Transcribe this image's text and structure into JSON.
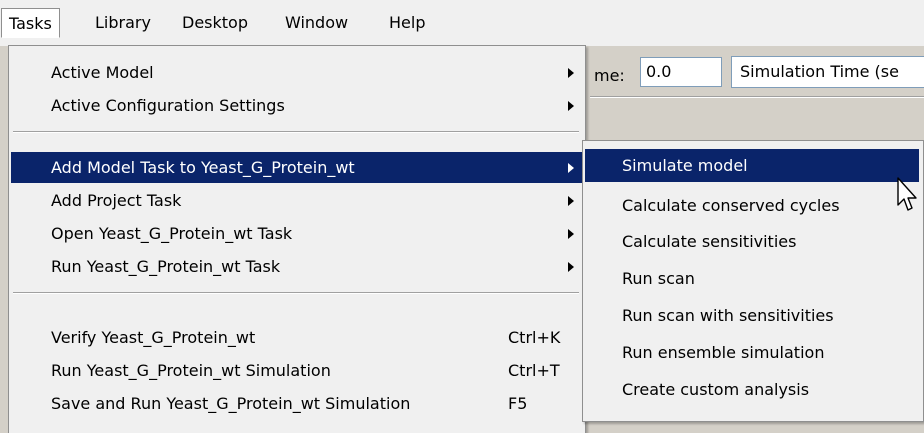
{
  "menubar": {
    "items": [
      {
        "label": "Tasks",
        "active": true
      },
      {
        "label": "Library"
      },
      {
        "label": "Desktop"
      },
      {
        "label": "Window"
      },
      {
        "label": "Help"
      }
    ]
  },
  "background": {
    "time_label": "me:",
    "time_value": "0.0",
    "time_unit_select": "Simulation Time (se"
  },
  "tasks_menu": {
    "items": [
      {
        "label": "Active Model",
        "submenu": true
      },
      {
        "label": "Active Configuration Settings",
        "submenu": true
      },
      {
        "label": "Add Model Task to Yeast_G_Protein_wt",
        "submenu": true,
        "highlighted": true
      },
      {
        "label": "Add Project Task",
        "submenu": true
      },
      {
        "label": "Open Yeast_G_Protein_wt Task",
        "submenu": true
      },
      {
        "label": "Run Yeast_G_Protein_wt Task",
        "submenu": true
      },
      {
        "label": "Verify Yeast_G_Protein_wt",
        "shortcut": "Ctrl+K"
      },
      {
        "label": "Run Yeast_G_Protein_wt Simulation",
        "shortcut": "Ctrl+T"
      },
      {
        "label": "Save and Run Yeast_G_Protein_wt Simulation",
        "shortcut": "F5"
      }
    ]
  },
  "submenu": {
    "items": [
      {
        "label": "Simulate model",
        "highlighted": true
      },
      {
        "label": "Calculate conserved cycles"
      },
      {
        "label": "Calculate sensitivities"
      },
      {
        "label": "Run scan"
      },
      {
        "label": "Run scan with sensitivities"
      },
      {
        "label": "Run ensemble simulation"
      },
      {
        "label": "Create custom analysis"
      }
    ]
  },
  "colors": {
    "highlight": "#0a246a",
    "menu_background": "#f0f0f0"
  }
}
